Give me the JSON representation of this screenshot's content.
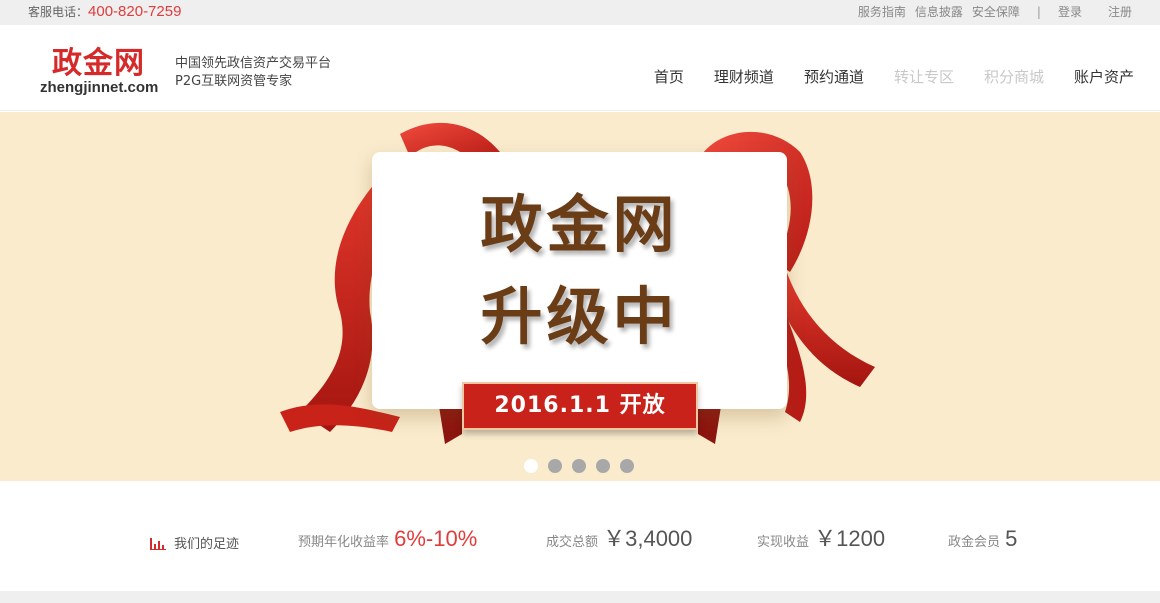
{
  "topbar": {
    "hotline_label": "客服电话：",
    "hotline_number": "400-820-7259",
    "links": [
      "服务指南",
      "信息披露",
      "安全保障"
    ],
    "separator": "|",
    "login": "登录",
    "register": "注册"
  },
  "header": {
    "logo_cn": "政金网",
    "logo_en": "zhengjinnet.com",
    "slogan_line1": "中国领先政信资产交易平台",
    "slogan_line2": "P2G互联网资管专家",
    "nav": [
      "首页",
      "理财频道",
      "预约通道",
      "转让专区",
      "积分商城",
      "账户资产"
    ]
  },
  "banner": {
    "line1": "政金网",
    "line2": "升级中",
    "ribbon_text": "2016.1.1 开放",
    "dots": 5,
    "active_dot": 1
  },
  "stats": {
    "footprint_label": "我们的足迹",
    "yield_label": "预期年化收益率",
    "yield_value": "6%-10%",
    "volume_label": "成交总额",
    "volume_value": "￥3,4000",
    "income_label": "实现收益",
    "income_value": "￥1200",
    "members_label": "政金会员",
    "members_value": "5"
  },
  "colors": {
    "accent_red": "#e03c3c",
    "logo_red": "#d62a2a",
    "banner_bg": "#f9ebcc",
    "title_brown": "#6a3d17",
    "ribbon_red": "#c8221b"
  },
  "icons": {
    "footprint": "bar-chart-icon"
  }
}
